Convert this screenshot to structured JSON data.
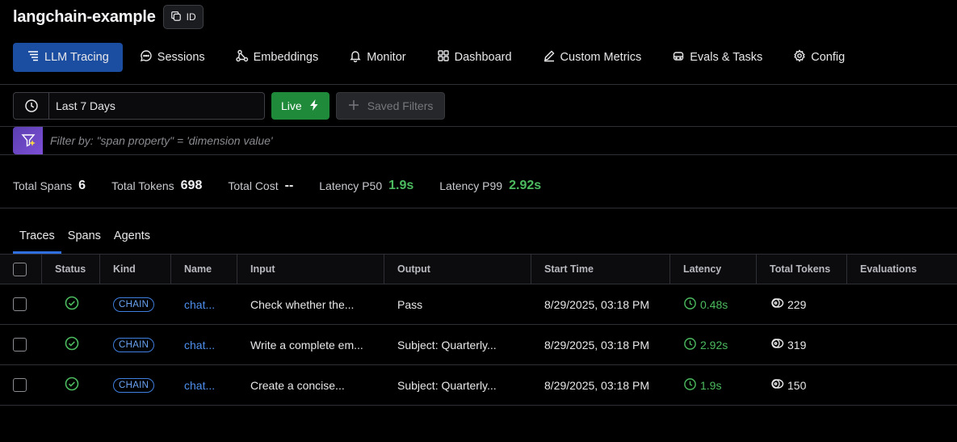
{
  "header": {
    "project_name": "langchain-example",
    "id_button_label": "ID"
  },
  "nav": {
    "tabs": [
      {
        "label": "LLM Tracing",
        "icon": "tracing-icon",
        "active": true
      },
      {
        "label": "Sessions",
        "icon": "chat-bubble-icon"
      },
      {
        "label": "Embeddings",
        "icon": "embeddings-icon"
      },
      {
        "label": "Monitor",
        "icon": "bell-icon"
      },
      {
        "label": "Dashboard",
        "icon": "grid-icon"
      },
      {
        "label": "Custom Metrics",
        "icon": "pencil-icon"
      },
      {
        "label": "Evals & Tasks",
        "icon": "robot-icon"
      },
      {
        "label": "Config",
        "icon": "gear-icon"
      }
    ]
  },
  "toolbar": {
    "time_range": "Last 7 Days",
    "live_label": "Live",
    "saved_filters_label": "Saved Filters"
  },
  "filter": {
    "placeholder": "Filter by: \"span property\" = 'dimension value'"
  },
  "stats": {
    "total_spans_label": "Total Spans",
    "total_spans": "6",
    "total_tokens_label": "Total Tokens",
    "total_tokens": "698",
    "total_cost_label": "Total Cost",
    "total_cost": "--",
    "latency_p50_label": "Latency P50",
    "latency_p50": "1.9s",
    "latency_p99_label": "Latency P99",
    "latency_p99": "2.92s"
  },
  "tabs": [
    {
      "label": "Traces",
      "active": true
    },
    {
      "label": "Spans"
    },
    {
      "label": "Agents"
    }
  ],
  "table": {
    "columns": [
      "Status",
      "Kind",
      "Name",
      "Input",
      "Output",
      "Start Time",
      "Latency",
      "Total Tokens",
      "Evaluations"
    ],
    "rows": [
      {
        "status": "ok",
        "kind": "CHAIN",
        "name": "chat...",
        "input": "Check whether the...",
        "output": "Pass",
        "start_time": "8/29/2025, 03:18 PM",
        "latency": "0.48s",
        "tokens": "229",
        "evaluations": ""
      },
      {
        "status": "ok",
        "kind": "CHAIN",
        "name": "chat...",
        "input": "Write a complete em...",
        "output": "Subject: Quarterly...",
        "start_time": "8/29/2025, 03:18 PM",
        "latency": "2.92s",
        "tokens": "319",
        "evaluations": ""
      },
      {
        "status": "ok",
        "kind": "CHAIN",
        "name": "chat...",
        "input": "Create a concise...",
        "output": "Subject: Quarterly...",
        "start_time": "8/29/2025, 03:18 PM",
        "latency": "1.9s",
        "tokens": "150",
        "evaluations": ""
      }
    ]
  },
  "colors": {
    "accent": "#1b4da0",
    "live": "#1f8a3a",
    "success": "#4cbb5f",
    "link": "#4e8fee"
  }
}
